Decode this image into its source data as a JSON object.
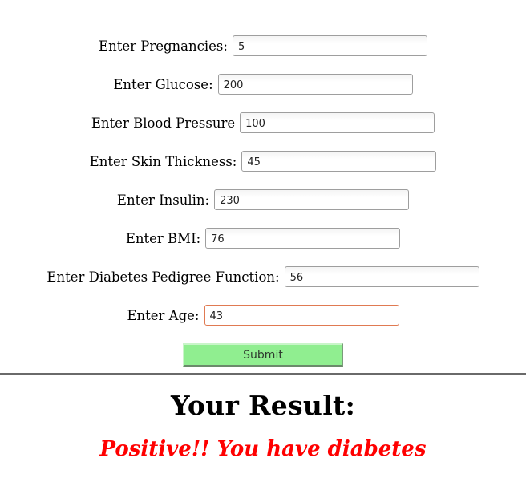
{
  "form": {
    "fields": [
      {
        "label": "Enter Pregnancies:",
        "value": "5"
      },
      {
        "label": "Enter Glucose:",
        "value": "200"
      },
      {
        "label": "Enter Blood Pressure",
        "value": "100"
      },
      {
        "label": "Enter Skin Thickness:",
        "value": "45"
      },
      {
        "label": "Enter Insulin:",
        "value": "230"
      },
      {
        "label": "Enter BMI:",
        "value": "76"
      },
      {
        "label": "Enter Diabetes Pedigree Function:",
        "value": "56"
      },
      {
        "label": "Enter Age:",
        "value": "43"
      }
    ],
    "submit_label": "Submit"
  },
  "result": {
    "heading": "Your Result:",
    "message": "Positive!! You have diabetes",
    "message_color": "#ff0000"
  },
  "colors": {
    "submit_bg": "#90ee90",
    "focus_border": "#e07a52"
  }
}
